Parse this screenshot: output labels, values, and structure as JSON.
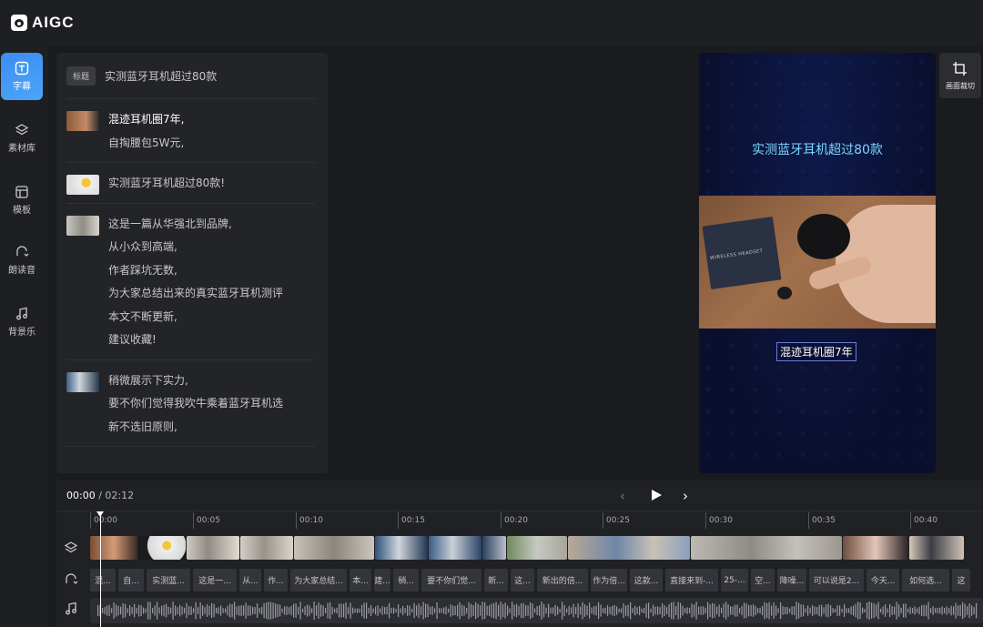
{
  "app": {
    "logo_text": "AIGC"
  },
  "sidebar": {
    "items": [
      {
        "label": "字幕",
        "icon": "subtitle-icon",
        "active": true
      },
      {
        "label": "素材库",
        "icon": "layers-icon",
        "active": false
      },
      {
        "label": "模板",
        "icon": "template-icon",
        "active": false
      },
      {
        "label": "朗读音",
        "icon": "voice-icon",
        "active": false
      },
      {
        "label": "背景乐",
        "icon": "music-note-icon",
        "active": false
      }
    ]
  },
  "subtitle_list": {
    "title_tag": "标题",
    "title_text": "实测蓝牙耳机超过80款",
    "groups": [
      {
        "lines": [
          "混迹耳机圈7年,",
          "自掏腰包5W元,"
        ]
      },
      {
        "lines": [
          "实测蓝牙耳机超过80款!"
        ]
      },
      {
        "lines": [
          "这是一篇从华强北到品牌,",
          "从小众到高端,",
          "作者踩坑无数,",
          "为大家总结出来的真实蓝牙耳机测评",
          "本文不断更新,",
          "建议收藏!"
        ]
      },
      {
        "lines": [
          "稍微展示下实力,",
          "要不你们觉得我吹牛乘着蓝牙耳机选",
          "新不选旧原则,"
        ]
      }
    ]
  },
  "preview": {
    "title": "实测蓝牙耳机超过80款",
    "box_text": "WIRELESS HEADSET",
    "caption": "混迹耳机圈7年"
  },
  "crop_button": {
    "label": "画面裁切"
  },
  "timeline": {
    "current_time": "00:00",
    "separator": " / ",
    "total_time": "02:12",
    "ruler_labels": [
      "00:00",
      "00:05",
      "00:10",
      "00:15",
      "00:20",
      "00:25",
      "00:30",
      "00:35",
      "00:40"
    ],
    "voice_chips": [
      "混...",
      "自...",
      "实测蓝...",
      "这是一...",
      "从...",
      "作...",
      "为大家总结...",
      "本...",
      "建...",
      "稍...",
      "要不你们觉...",
      "新...",
      "这...",
      "新出的倍...",
      "作为倍...",
      "这款...",
      "直接来到-...",
      "25-...",
      "空...",
      "降噪...",
      "可以说是2...",
      "今天...",
      "如何选...",
      "这"
    ]
  },
  "colors": {
    "accent": "#3d8cf3",
    "preview_title": "#7ed6ff",
    "panel_bg": "#232428"
  }
}
